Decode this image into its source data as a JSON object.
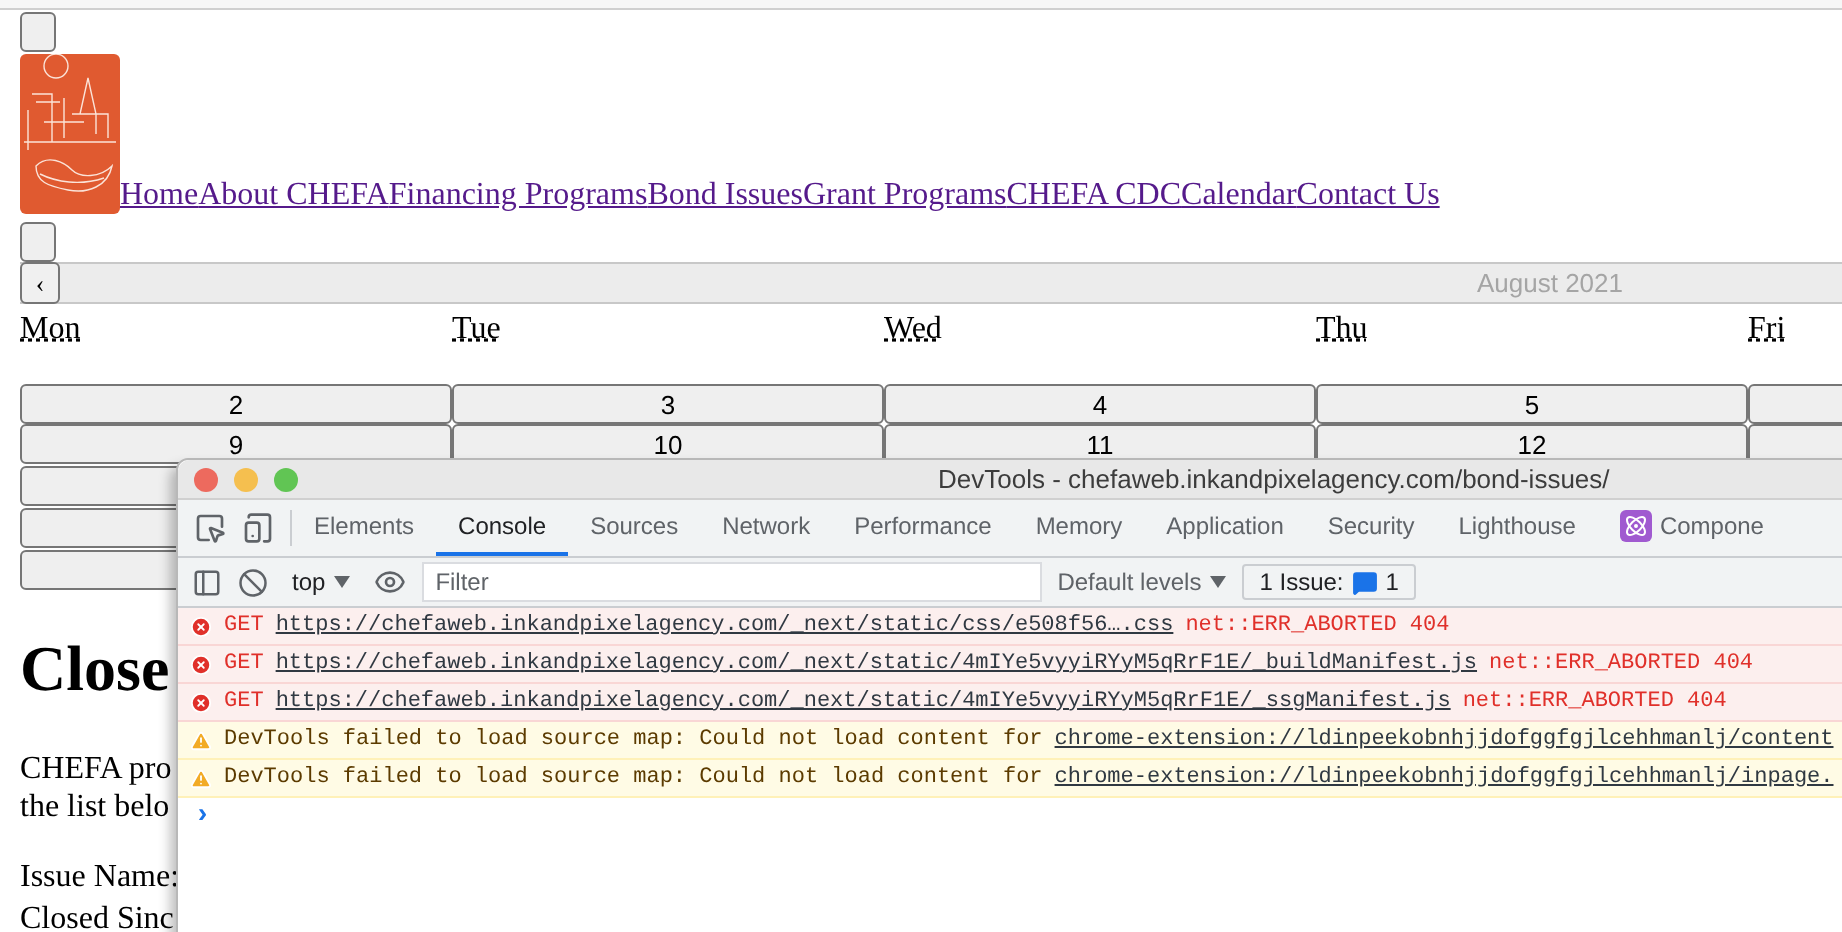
{
  "nav": {
    "links": [
      "Home",
      "About CHEFA",
      "Financing Programs",
      "Bond Issues",
      "Grant Programs",
      "CHEFA CDC",
      "Calendar",
      "Contact Us"
    ]
  },
  "calendar": {
    "prev": "‹",
    "month": "August 2021",
    "weekdays": [
      "Mon",
      "Tue",
      "Wed",
      "Thu",
      "Fri"
    ],
    "weeks": [
      {
        "days": [
          "2",
          "3",
          "4",
          "5"
        ]
      },
      {
        "days": [
          "9",
          "10",
          "11",
          "12"
        ]
      }
    ]
  },
  "content": {
    "heading": "Close",
    "paragraph_lines": [
      "CHEFA pro",
      "the list belo"
    ],
    "fields": [
      "Issue Name:",
      "Closed Sinc"
    ]
  },
  "devtools": {
    "title": "DevTools - chefaweb.inkandpixelagency.com/bond-issues/",
    "tabs": [
      {
        "label": "Elements",
        "selected": false,
        "kind": "text"
      },
      {
        "label": "Console",
        "selected": true,
        "kind": "text"
      },
      {
        "label": "Sources",
        "selected": false,
        "kind": "text"
      },
      {
        "label": "Network",
        "selected": false,
        "kind": "text"
      },
      {
        "label": "Performance",
        "selected": false,
        "kind": "text"
      },
      {
        "label": "Memory",
        "selected": false,
        "kind": "text"
      },
      {
        "label": "Application",
        "selected": false,
        "kind": "text"
      },
      {
        "label": "Security",
        "selected": false,
        "kind": "text"
      },
      {
        "label": "Lighthouse",
        "selected": false,
        "kind": "text"
      },
      {
        "label": "Compone",
        "selected": false,
        "kind": "react"
      }
    ],
    "toolbar": {
      "context": "top",
      "filter_placeholder": "Filter",
      "levels": "Default levels",
      "issues_label": "1 Issue:",
      "issues_count": "1"
    },
    "messages": [
      {
        "kind": "error",
        "method": "GET",
        "url": "https://chefaweb.inkandpixelagency.com/_next/static/css/e508f56….css",
        "status": "net::ERR_ABORTED 404"
      },
      {
        "kind": "error",
        "method": "GET",
        "url": "https://chefaweb.inkandpixelagency.com/_next/static/4mIYe5vyyiRYyM5qRrF1E/_buildManifest.js",
        "status": "net::ERR_ABORTED 404"
      },
      {
        "kind": "error",
        "method": "GET",
        "url": "https://chefaweb.inkandpixelagency.com/_next/static/4mIYe5vyyiRYyM5qRrF1E/_ssgManifest.js",
        "status": "net::ERR_ABORTED 404"
      },
      {
        "kind": "warning",
        "text": "DevTools failed to load source map: Could not load content for",
        "url": "chrome-extension://ldinpeekobnhjjdofggfgjlcehhmanlj/content"
      },
      {
        "kind": "warning",
        "text": "DevTools failed to load source map: Could not load content for",
        "url": "chrome-extension://ldinpeekobnhjjdofggfgjlcehhmanlj/inpage."
      }
    ],
    "prompt": "›"
  }
}
